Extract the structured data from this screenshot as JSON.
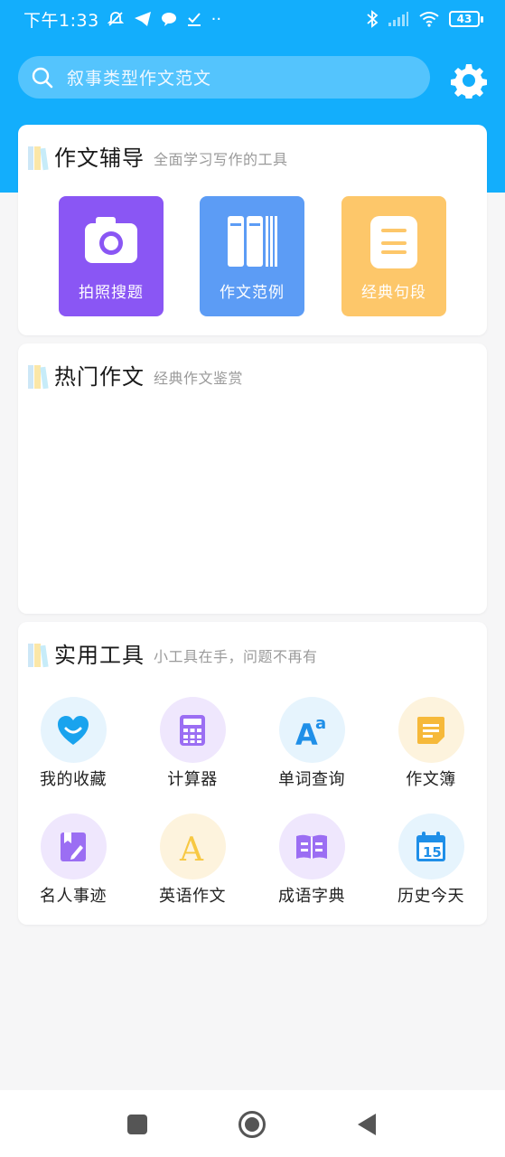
{
  "status": {
    "time": "下午1:33",
    "battery": "43",
    "dots": "··"
  },
  "search": {
    "placeholder": "叙事类型作文范文"
  },
  "colors": {
    "primary": "#13aefc",
    "photo_tile": "#8a56f4",
    "example_tile": "#5c9cf5",
    "sentence_tile": "#fdc76a"
  },
  "section_guidance": {
    "title": "作文辅导",
    "subtitle": "全面学习写作的工具",
    "tiles": [
      {
        "label": "拍照搜题",
        "icon": "camera-icon"
      },
      {
        "label": "作文范例",
        "icon": "books-icon"
      },
      {
        "label": "经典句段",
        "icon": "note-icon"
      }
    ]
  },
  "section_hot": {
    "title": "热门作文",
    "subtitle": "经典作文鉴赏"
  },
  "section_tools": {
    "title": "实用工具",
    "subtitle": "小工具在手，问题不再有",
    "items": [
      {
        "label": "我的收藏",
        "icon": "heart-icon"
      },
      {
        "label": "计算器",
        "icon": "calculator-icon"
      },
      {
        "label": "单词查询",
        "icon": "word-lookup-icon"
      },
      {
        "label": "作文簿",
        "icon": "notebook-icon"
      },
      {
        "label": "名人事迹",
        "icon": "bookmark-pen-icon"
      },
      {
        "label": "英语作文",
        "icon": "letter-a-icon"
      },
      {
        "label": "成语字典",
        "icon": "open-book-icon"
      },
      {
        "label": "历史今天",
        "icon": "calendar-icon"
      }
    ],
    "calendar_day": "15"
  },
  "nav": {
    "buttons": [
      "recents-button",
      "home-button",
      "back-button"
    ]
  }
}
